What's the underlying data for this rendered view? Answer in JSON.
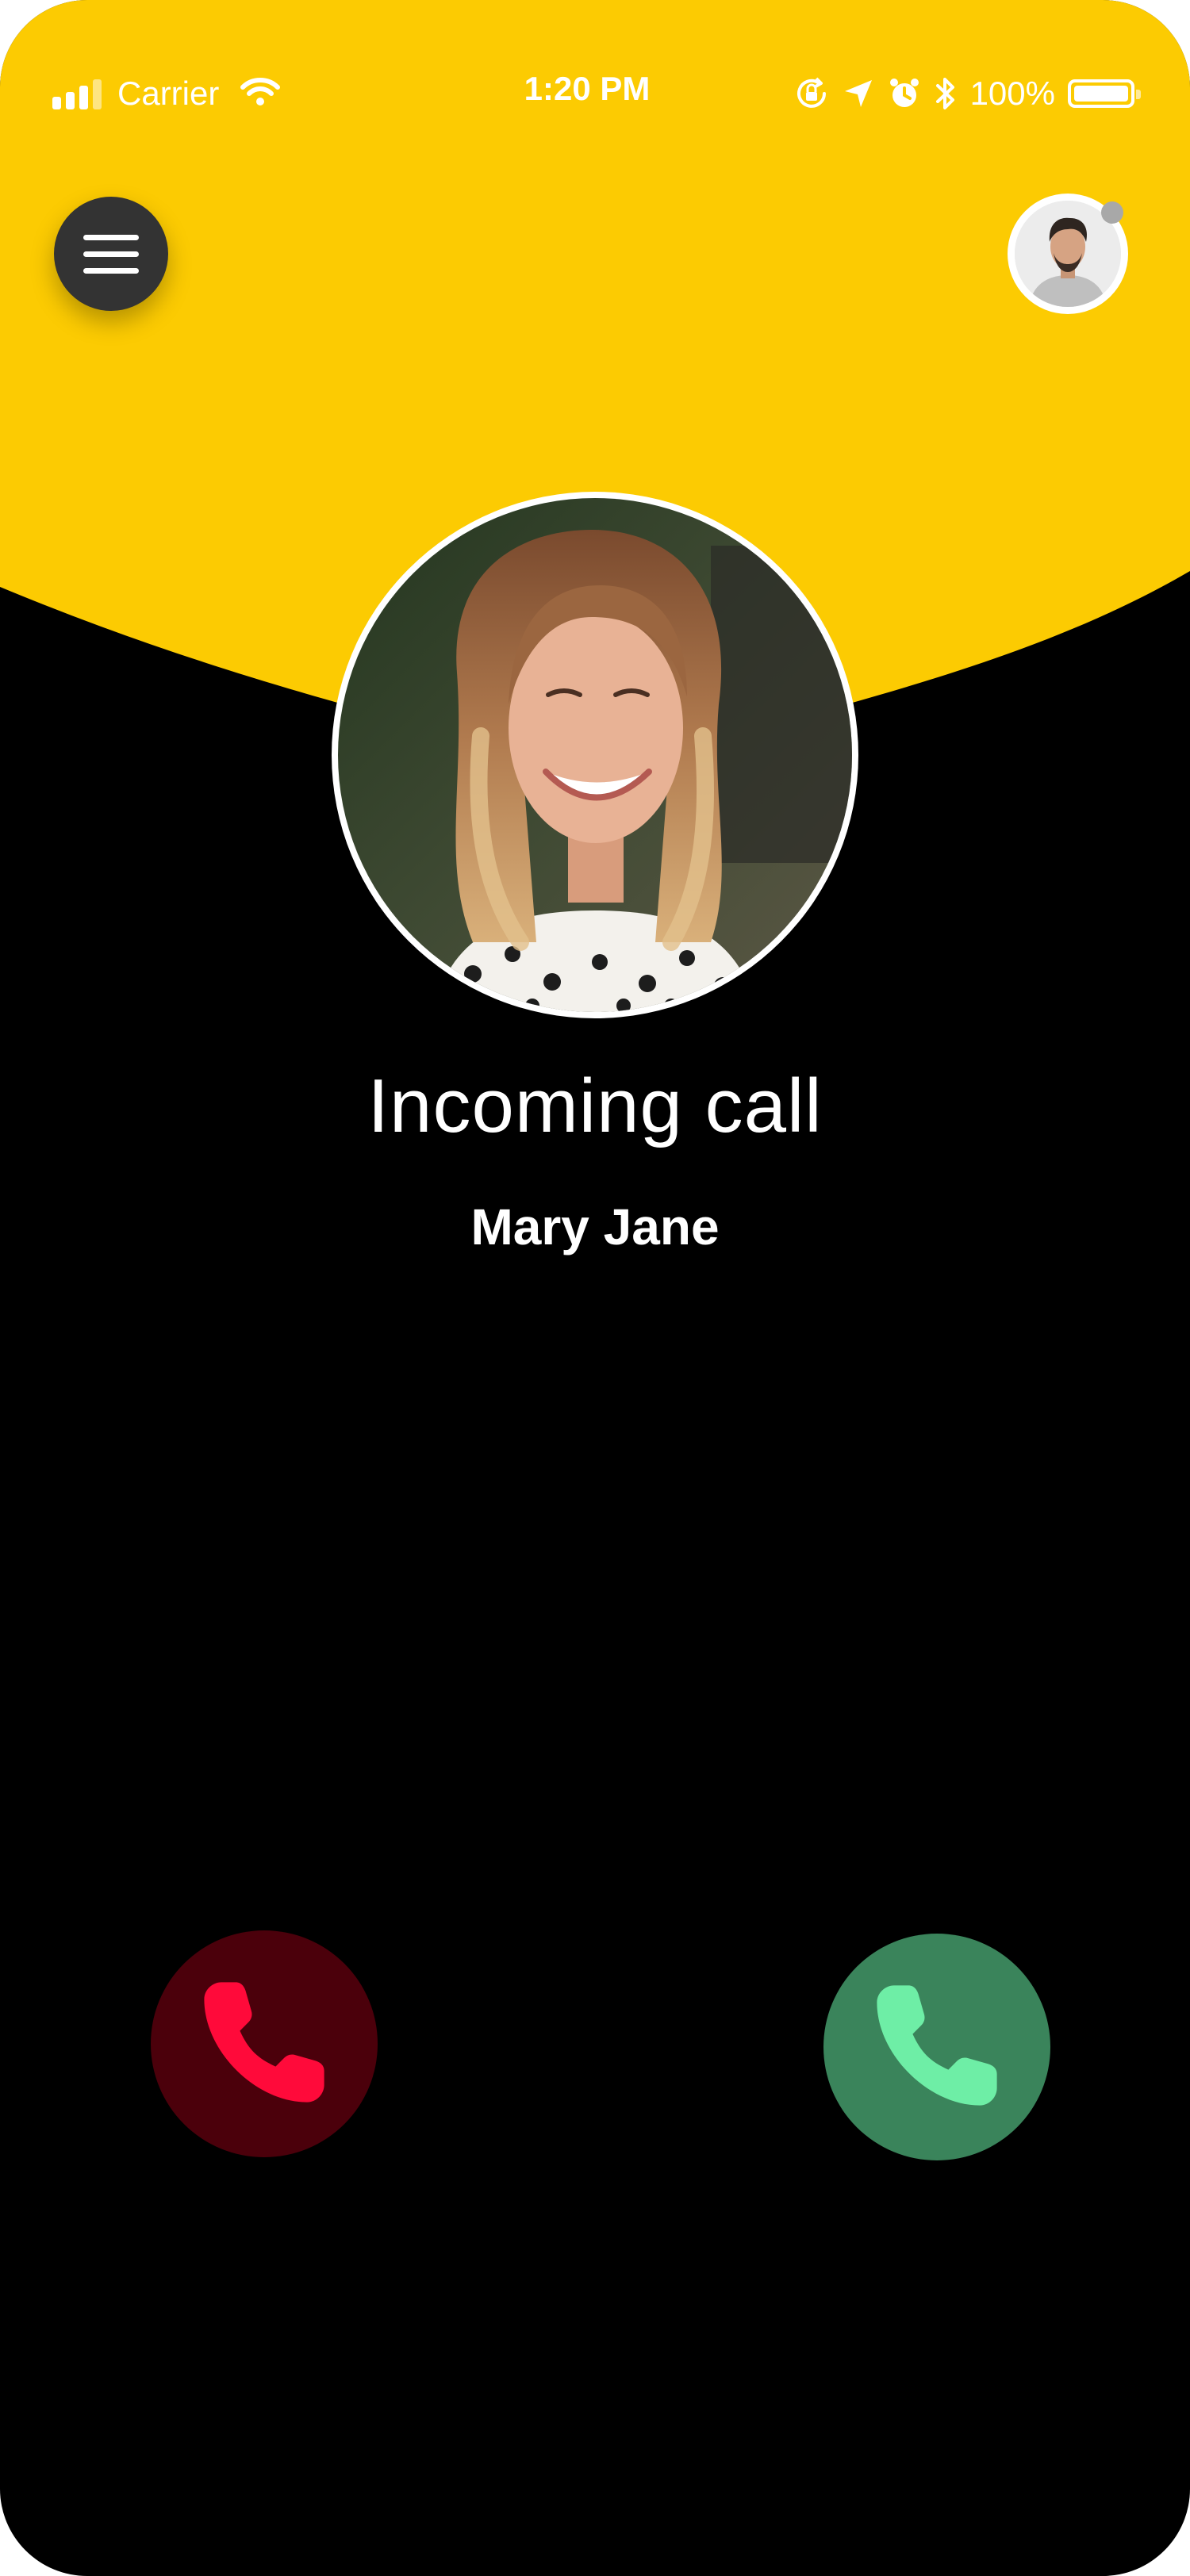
{
  "status_bar": {
    "carrier": "Carrier",
    "time": "1:20 PM",
    "battery_percent": "100%",
    "battery_level": 1.0,
    "icons": [
      "signal-icon",
      "wifi-icon",
      "orientation-lock-icon",
      "location-icon",
      "alarm-icon",
      "bluetooth-icon",
      "battery-icon"
    ]
  },
  "header": {
    "menu_icon": "hamburger-menu-icon",
    "profile_status": "presence-indicator"
  },
  "call": {
    "status": "Incoming call",
    "caller_name": "Mary Jane"
  },
  "actions": {
    "decline_icon": "phone-decline-icon",
    "accept_icon": "phone-accept-icon"
  },
  "colors": {
    "header_yellow": "#fccb02",
    "background": "#000000",
    "decline_bg": "#4b000b",
    "decline_icon": "#ff0a3a",
    "accept_bg": "#3a845b",
    "accept_icon": "#6eeea6",
    "menu_bg": "#333333"
  }
}
